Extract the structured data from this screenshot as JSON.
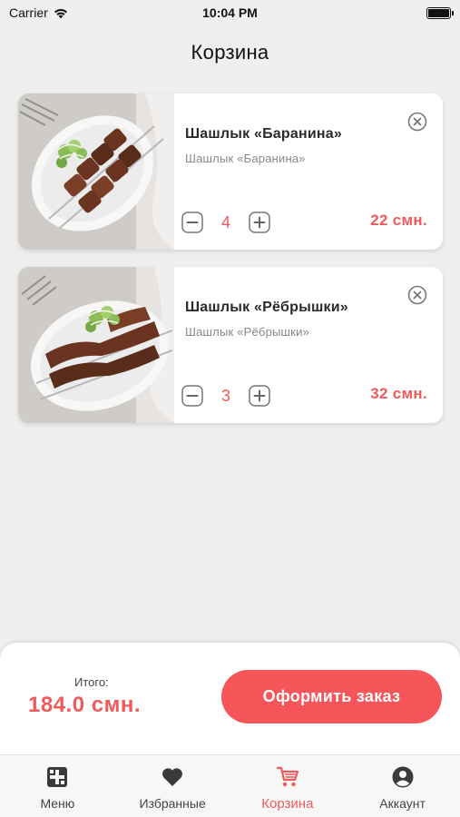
{
  "status_bar": {
    "carrier": "Carrier",
    "time": "10:04 PM"
  },
  "page": {
    "title": "Корзина"
  },
  "cart": {
    "items": [
      {
        "name": "Шашлык «Баранина»",
        "subtitle": "Шашлык «Баранина»",
        "quantity": "4",
        "price": "22 смн."
      },
      {
        "name": "Шашлык «Рёбрышки»",
        "subtitle": "Шашлык «Рёбрышки»",
        "quantity": "3",
        "price": "32 смн."
      }
    ]
  },
  "checkout": {
    "total_label": "Итого:",
    "total_value": "184.0 смн.",
    "order_button": "Оформить заказ"
  },
  "tab_bar": {
    "tabs": [
      {
        "label": "Меню",
        "icon": "menu-grid-icon"
      },
      {
        "label": "Избранные",
        "icon": "heart-icon"
      },
      {
        "label": "Корзина",
        "icon": "cart-icon",
        "active": true
      },
      {
        "label": "Аккаунт",
        "icon": "account-icon"
      }
    ]
  },
  "colors": {
    "accent": "#f05a5b",
    "button": "#f6555a",
    "background": "#efefef"
  }
}
